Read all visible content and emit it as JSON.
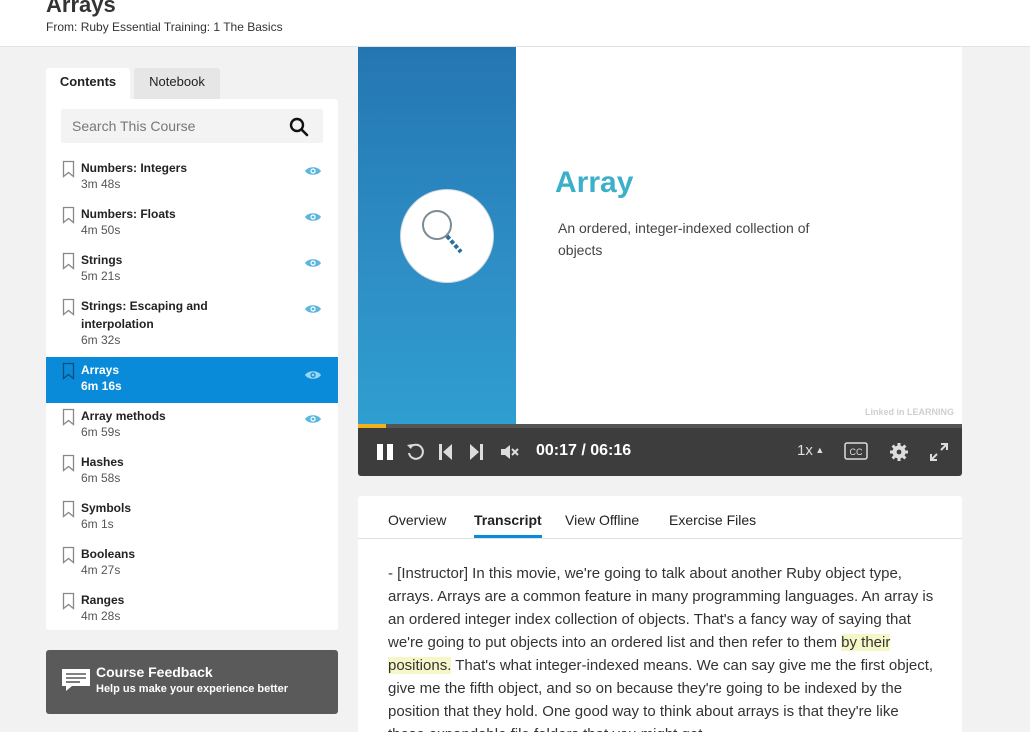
{
  "header": {
    "title": "Arrays",
    "from_label": "From:",
    "course_name": "Ruby Essential Training: 1 The Basics"
  },
  "sidebar": {
    "tabs": [
      {
        "label": "Contents",
        "active": true
      },
      {
        "label": "Notebook",
        "active": false
      }
    ],
    "search_placeholder": "Search This Course",
    "items": [
      {
        "title": "Numbers: Integers",
        "duration": "3m 48s",
        "watched": true
      },
      {
        "title": "Numbers: Floats",
        "duration": "4m 50s",
        "watched": true
      },
      {
        "title": "Strings",
        "duration": "5m 21s",
        "watched": true
      },
      {
        "title": "Strings: Escaping and interpolation",
        "duration": "6m 32s",
        "watched": true
      },
      {
        "title": "Arrays",
        "duration": "6m 16s",
        "watched": true,
        "active": true
      },
      {
        "title": "Array methods",
        "duration": "6m 59s",
        "watched": true
      },
      {
        "title": "Hashes",
        "duration": "6m 58s",
        "watched": false
      },
      {
        "title": "Symbols",
        "duration": "6m 1s",
        "watched": false
      },
      {
        "title": "Booleans",
        "duration": "4m 27s",
        "watched": false
      },
      {
        "title": "Ranges",
        "duration": "4m 28s",
        "watched": false
      }
    ],
    "feedback": {
      "title": "Course Feedback",
      "subtitle": "Help us make your experience better"
    }
  },
  "video": {
    "slide_heading": "Array",
    "slide_text": "An ordered, integer-indexed collection of objects",
    "watermark": "Linked in LEARNING",
    "progress_fraction": 0.046,
    "time": "00:17 / 06:16",
    "speed": "1x"
  },
  "transcript": {
    "tabs": [
      "Overview",
      "Transcript",
      "View Offline",
      "Exercise Files"
    ],
    "active_tab": "Transcript",
    "text_before": "- [Instructor] In this movie, we're going to talk about another Ruby object type, arrays. Arrays are a common feature in many programming languages. An array is an ordered integer index collection of objects. That's a fancy way of saying that we're going to put objects into an ordered list and then refer to them ",
    "text_highlight": "by their positions.",
    "text_after": " That's what integer-indexed means. We can say give me the first object, give me the fifth object, and so on because they're going to be indexed by the position that they hold. One good way to think about arrays is that they're like those expandable file folders that you might get"
  },
  "colors": {
    "accent": "#0a8bd9",
    "progress": "#f2b21c",
    "slide_heading": "#3cb0c9"
  }
}
